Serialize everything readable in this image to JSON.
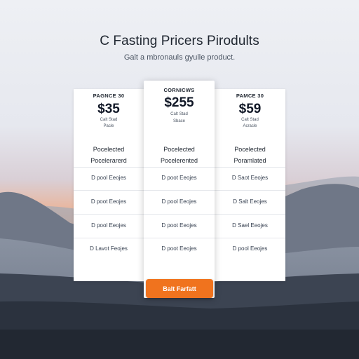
{
  "header": {
    "title": "C Fasting Pricers Pirodults",
    "subtitle": "Galt a mbronauls gyulle product."
  },
  "plans": [
    {
      "name": "PAGNCE 30",
      "price": "$35",
      "note_line1": "Calt Stad",
      "note_line2": "Pacle",
      "feature1": "Pocelected",
      "feature2": "Pocelerarerd",
      "rows": [
        "D pool Eeojes",
        "D poot Eeojes",
        "D pool Eeojes",
        "D Lavot Feojes"
      ]
    },
    {
      "name": "CORNICWS",
      "price": "$255",
      "note_line1": "Calt Stad",
      "note_line2": "Sbace",
      "feature1": "Pocelected",
      "feature2": "Pocelerented",
      "rows": [
        "D poot Eeojes",
        "D pool Eeojes",
        "D poot Eeojes",
        "D poot Eeojes"
      ]
    },
    {
      "name": "PAMCE 30",
      "price": "$59",
      "note_line1": "Calt Stad",
      "note_line2": "Acracle",
      "feature1": "Pocelected",
      "feature2": "Poramlated",
      "rows": [
        "D Saot Eeojes",
        "D Salt Eeojes",
        "D Sael Eeojes",
        "D pool Eeojes"
      ]
    }
  ],
  "cta": {
    "label": "Balt Farfatt"
  },
  "colors": {
    "accent": "#f0731e",
    "card": "#ffffff",
    "text": "#1f2630"
  }
}
